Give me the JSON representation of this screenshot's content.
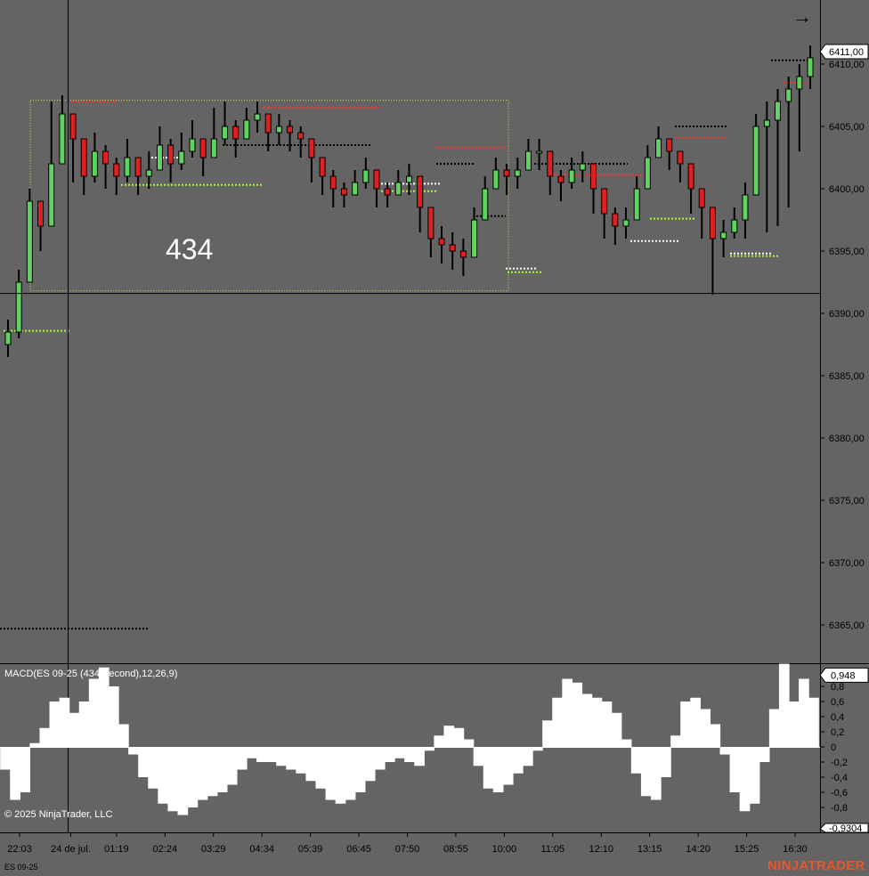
{
  "chart_data": [
    {
      "type": "candlestick",
      "instrument": "ES 09-25",
      "box_label": "434",
      "price_axis": {
        "ylim": [
          6361.5,
          6414.5
        ],
        "ticks": [
          "6410,00",
          "6405,00",
          "6400,00",
          "6395,00",
          "6390,00",
          "6385,00",
          "6380,00",
          "6375,00",
          "6370,00",
          "6365,00"
        ],
        "tick_values": [
          6410,
          6405,
          6400,
          6395,
          6390,
          6385,
          6380,
          6375,
          6370,
          6365
        ],
        "last_price_label": "6411,00",
        "last_price": 6411.0
      },
      "time_axis": {
        "labels": [
          "22:03",
          "24 de jul.",
          "01:19",
          "02:24",
          "03:29",
          "04:34",
          "05:39",
          "06:45",
          "07:50",
          "08:55",
          "10:00",
          "11:05",
          "12:10",
          "13:15",
          "14:20",
          "15:25",
          "16:30"
        ]
      },
      "crosshair": {
        "price": 6391.6,
        "time_label": "24 de jul."
      },
      "range_box": {
        "price_high": 6407.1,
        "price_low": 6391.8
      },
      "series": [
        {
          "name": "ES 09-25",
          "close_path": [
            6388.5,
            6392.5,
            6399,
            6397,
            6402,
            6406,
            6404,
            6401,
            6403,
            6402,
            6401,
            6402.5,
            6401,
            6401.5,
            6403.5,
            6402,
            6403,
            6404,
            6402.5,
            6404,
            6405,
            6404,
            6405.5,
            6406,
            6404.5,
            6405,
            6404.5,
            6404,
            6402.5,
            6401,
            6400,
            6399.5,
            6400.5,
            6401.5,
            6400,
            6399.5,
            6400.5,
            6401,
            6398.5,
            6396,
            6395.5,
            6395,
            6394.5,
            6397.5,
            6400,
            6401.5,
            6401,
            6401.5,
            6403,
            6403,
            6401,
            6400.5,
            6401.5,
            6402,
            6400,
            6398,
            6397,
            6397.5,
            6400,
            6402.5,
            6404,
            6403,
            6402,
            6400,
            6398.5,
            6396,
            6396.5,
            6397.5,
            6399.5,
            6405,
            6405.5,
            6407,
            6408,
            6409,
            6410.5
          ],
          "highs": [
            6389.5,
            6393.5,
            6400,
            6398.5,
            6407,
            6407.5,
            6405,
            6403,
            6404.5,
            6403.5,
            6402.5,
            6404,
            6402.5,
            6403,
            6405,
            6404,
            6404.5,
            6405.5,
            6404,
            6406.5,
            6407,
            6405.5,
            6406.5,
            6407,
            6406,
            6406,
            6405.5,
            6405,
            6403.5,
            6402,
            6401.5,
            6400.5,
            6401.5,
            6402.5,
            6401,
            6400.5,
            6401.5,
            6402,
            6400,
            6397.5,
            6397,
            6396.5,
            6396,
            6398.5,
            6401,
            6402.5,
            6402,
            6402.5,
            6404,
            6404,
            6402,
            6401.5,
            6402.5,
            6403,
            6401,
            6399.5,
            6398.5,
            6398.5,
            6401,
            6403.5,
            6405,
            6404,
            6403,
            6401,
            6399.5,
            6397.5,
            6397.5,
            6398.5,
            6400.5,
            6406,
            6407,
            6408,
            6409,
            6410,
            6411.5
          ],
          "lows": [
            6386.5,
            6388,
            6394.5,
            6395,
            6399,
            6402.5,
            6400.5,
            6399.5,
            6400.5,
            6400,
            6399.5,
            6400.5,
            6399.5,
            6400,
            6401.5,
            6400.5,
            6401.5,
            6402.5,
            6401,
            6402.5,
            6403.5,
            6402.5,
            6404,
            6404.5,
            6403,
            6403.5,
            6403,
            6402.5,
            6400.5,
            6399.5,
            6398.5,
            6398.5,
            6399.5,
            6400,
            6398.5,
            6398.5,
            6399.5,
            6399.5,
            6396.5,
            6394.5,
            6394,
            6393.5,
            6393,
            6395,
            6398.5,
            6400,
            6399.5,
            6400,
            6401.5,
            6401.5,
            6399.5,
            6399,
            6400,
            6400.5,
            6398,
            6396,
            6395.5,
            6396,
            6398.5,
            6401,
            6402.5,
            6401.5,
            6400.5,
            6398,
            6396,
            6391.5,
            6394.5,
            6396,
            6396,
            6400.5,
            6396.5,
            6397,
            6398.5,
            6403,
            6408
          ]
        }
      ]
    },
    {
      "type": "bar",
      "title": "MACD(ES 09-25 (434 Second),12,26,9)",
      "ylim": [
        -1.3,
        1.3
      ],
      "ticks": [
        "0,8",
        "0,6",
        "0,4",
        "0,2",
        "0",
        "-0,2",
        "-0,4",
        "-0,6",
        "-0,8"
      ],
      "tick_values": [
        0.8,
        0.6,
        0.4,
        0.2,
        0,
        -0.2,
        -0.4,
        -0.6,
        -0.8
      ],
      "last_value_label": "0,948",
      "last_value": 0.948,
      "min_label": "-0,9304",
      "series": [
        {
          "name": "MACD",
          "values": [
            -0.3,
            -0.7,
            -0.6,
            0.05,
            0.25,
            0.6,
            0.65,
            0.45,
            0.6,
            0.9,
            1.05,
            0.8,
            0.3,
            -0.1,
            -0.4,
            -0.55,
            -0.75,
            -0.85,
            -0.9,
            -0.8,
            -0.7,
            -0.65,
            -0.6,
            -0.5,
            -0.3,
            -0.15,
            -0.2,
            -0.2,
            -0.25,
            -0.3,
            -0.35,
            -0.45,
            -0.55,
            -0.7,
            -0.75,
            -0.7,
            -0.6,
            -0.45,
            -0.3,
            -0.2,
            -0.15,
            -0.2,
            -0.25,
            -0.05,
            0.15,
            0.28,
            0.25,
            0.1,
            -0.25,
            -0.55,
            -0.6,
            -0.5,
            -0.35,
            -0.25,
            -0.05,
            0.35,
            0.65,
            0.9,
            0.85,
            0.7,
            0.65,
            0.6,
            0.45,
            0.1,
            -0.35,
            -0.65,
            -0.7,
            -0.4,
            0.15,
            0.6,
            0.65,
            0.5,
            0.3,
            -0.1,
            -0.6,
            -0.85,
            -0.75,
            -0.2,
            0.5,
            1.1,
            0.6,
            0.9,
            0.65
          ]
        }
      ]
    }
  ],
  "labels": {
    "box_label": "434",
    "macd_title": "MACD(ES 09-25 (434 Second),12,26,9)",
    "copyright": "© 2025 NinjaTrader, LLC",
    "instrument": "ES 09-25",
    "brand": "NINJATRADER",
    "nav_arrow": "→"
  },
  "colors": {
    "background": "#646464",
    "up_candle": "#5fd35f",
    "down_candle": "#e02020",
    "wick": "#000000",
    "macd_bar": "#ffffff",
    "range_box": "#e0d24a",
    "level_red": "#ff3030",
    "level_green": "#a8ff2c",
    "level_black": "#000000",
    "level_white": "#ffffff",
    "brand": "#e8562a"
  },
  "icons": {
    "nav_arrow": "right-arrow-icon"
  }
}
